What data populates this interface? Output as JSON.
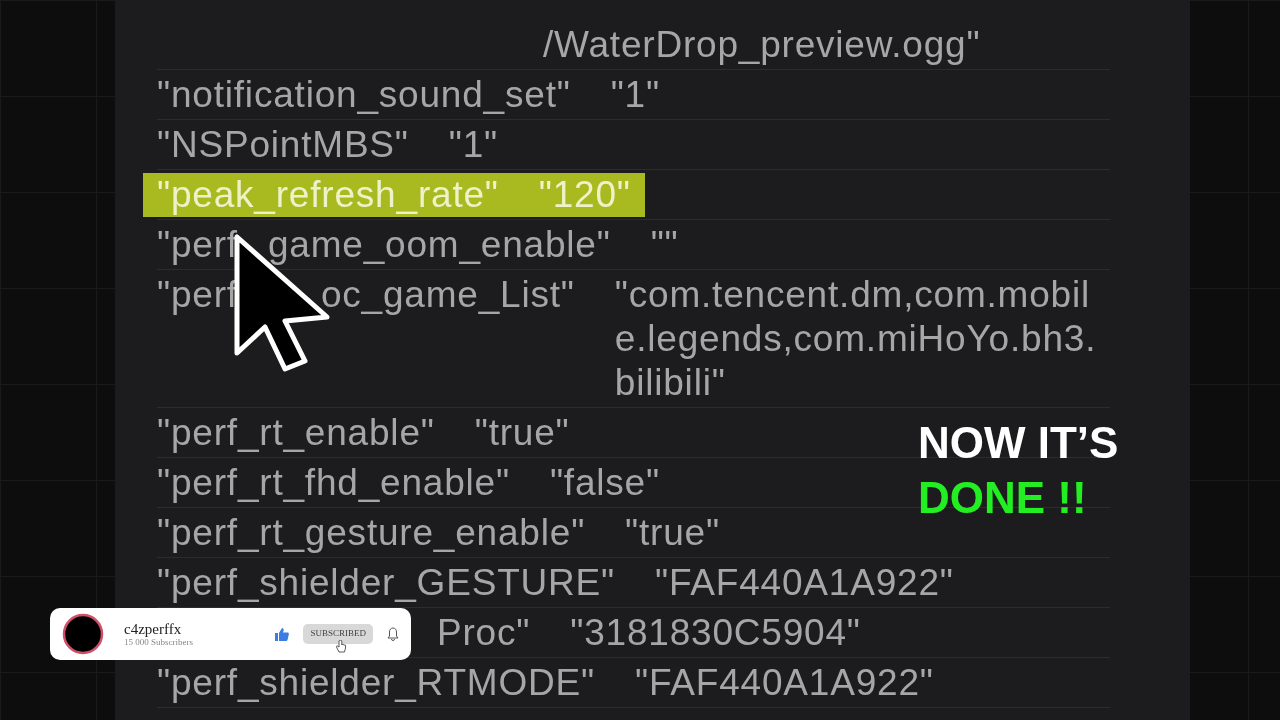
{
  "settings_list": [
    {
      "kind": "value_only",
      "value": "/WaterDrop_preview.ogg\""
    },
    {
      "kind": "plain",
      "key_parts": [
        "\"notification_sound_set\""
      ],
      "value": "\"1\""
    },
    {
      "kind": "plain",
      "key_parts": [
        "\"NSPointMBS\""
      ],
      "value": "\"1\""
    },
    {
      "kind": "plain",
      "key_parts": [
        "\"peak_refresh_rate\""
      ],
      "value": "\"120\"",
      "highlighted": true
    },
    {
      "kind": "split",
      "key_parts": [
        "\"perf",
        "game_oom_enable\""
      ],
      "value": "\"\""
    },
    {
      "kind": "split_wide",
      "key_parts": [
        "\"perf",
        "oc_game_List\""
      ],
      "value": "\"com.tencent.dm,com.mobile.legends,com.miHoYo.bh3.bilibili\""
    },
    {
      "kind": "plain",
      "key_parts": [
        "\"perf_rt_enable\""
      ],
      "value": "\"true\""
    },
    {
      "kind": "plain",
      "key_parts": [
        "\"perf_rt_fhd_enable\""
      ],
      "value": "\"false\""
    },
    {
      "kind": "plain",
      "key_parts": [
        "\"perf_rt_gesture_enable\""
      ],
      "value": "\"true\""
    },
    {
      "kind": "plain",
      "key_parts": [
        "\"perf_shielder_GESTURE\""
      ],
      "value": "\"FAF440A1A922\""
    },
    {
      "kind": "covered_start",
      "key_parts": [
        "Proc\""
      ],
      "value": "\"3181830C5904\""
    },
    {
      "kind": "plain",
      "key_parts": [
        "\"perf_shielder_RTMODE\""
      ],
      "value": "\"FAF440A1A922\""
    }
  ],
  "caption": {
    "line_1": "NOW IT’S",
    "line_2": "DONE !!"
  },
  "channel_card": {
    "name": "c4zperffx",
    "subscribers": "15 000 Subscribers",
    "button": "SUBSCRIBED"
  }
}
